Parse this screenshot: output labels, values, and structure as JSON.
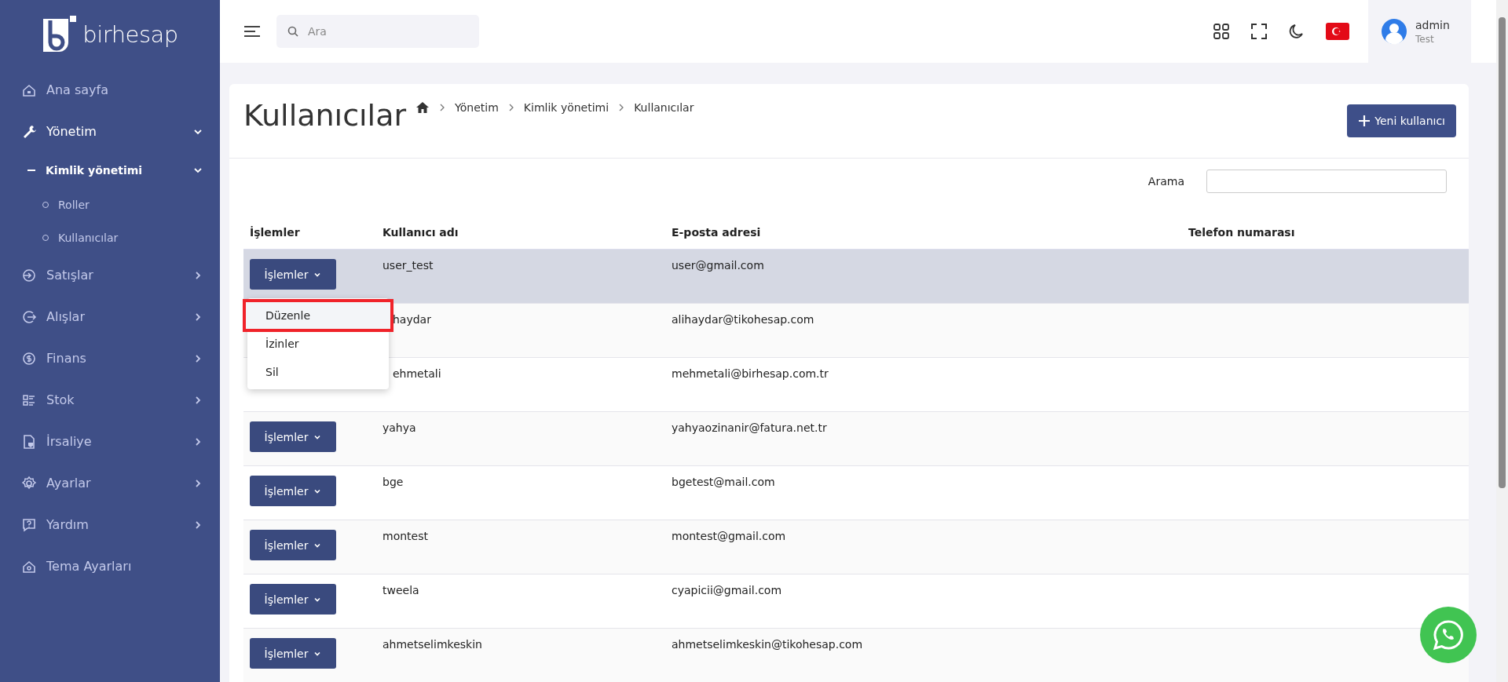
{
  "brand": {
    "name": "birhesap"
  },
  "sidebar": {
    "items": [
      {
        "label": "Ana sayfa",
        "active": false
      },
      {
        "label": "Yönetim",
        "active": true,
        "expanded": true,
        "children": [
          {
            "label": "Kimlik yönetimi",
            "active": true,
            "expanded": true,
            "children": [
              {
                "label": "Roller",
                "active": false
              },
              {
                "label": "Kullanıcılar",
                "active": false
              }
            ]
          }
        ]
      },
      {
        "label": "Satışlar",
        "active": false,
        "expanded": false
      },
      {
        "label": "Alışlar",
        "active": false,
        "expanded": false
      },
      {
        "label": "Finans",
        "active": false,
        "expanded": false
      },
      {
        "label": "Stok",
        "active": false,
        "expanded": false
      },
      {
        "label": "İrsaliye",
        "active": false,
        "expanded": false
      },
      {
        "label": "Ayarlar",
        "active": false,
        "expanded": false
      },
      {
        "label": "Yardım",
        "active": false,
        "expanded": false
      },
      {
        "label": "Tema Ayarları",
        "active": false
      }
    ]
  },
  "header": {
    "search": {
      "placeholder": "Ara"
    },
    "user": {
      "name": "admin",
      "role": "Test"
    }
  },
  "page": {
    "title": "Kullanıcılar",
    "breadcrumb": [
      "Yönetim",
      "Kimlik yönetimi",
      "Kullanıcılar"
    ],
    "new_button": "Yeni kullanıcı",
    "search_label": "Arama"
  },
  "table": {
    "columns": [
      "İşlemler",
      "Kullanıcı adı",
      "E-posta adresi",
      "Telefon numarası"
    ],
    "rows": [
      {
        "selected": true,
        "covered": false,
        "action": "İşlemler",
        "username": "user_test",
        "email": "user@gmail.com"
      },
      {
        "selected": false,
        "covered": true,
        "username": "haydar",
        "email": "alihaydar@tikohesap.com"
      },
      {
        "selected": false,
        "covered": true,
        "username": "ehmetali",
        "email": "mehmetali@birhesap.com.tr"
      },
      {
        "selected": false,
        "covered": false,
        "action": "İşlemler",
        "username": "yahya",
        "email": "yahyaozinanir@fatura.net.tr"
      },
      {
        "selected": false,
        "covered": false,
        "action": "İşlemler",
        "username": "bge",
        "email": "bgetest@mail.com"
      },
      {
        "selected": false,
        "covered": false,
        "action": "İşlemler",
        "username": "montest",
        "email": "montest@gmail.com"
      },
      {
        "selected": false,
        "covered": false,
        "action": "İşlemler",
        "username": "tweela",
        "email": "cyapicii@gmail.com"
      },
      {
        "selected": false,
        "covered": false,
        "action": "İşlemler",
        "username": "ahmetselimkeskin",
        "email": "ahmetselimkeskin@tikohesap.com"
      }
    ]
  },
  "dropdown": {
    "items": [
      {
        "label": "Düzenle",
        "highlighted": true
      },
      {
        "label": "İzinler",
        "highlighted": false
      },
      {
        "label": "Sil",
        "highlighted": false
      }
    ]
  }
}
